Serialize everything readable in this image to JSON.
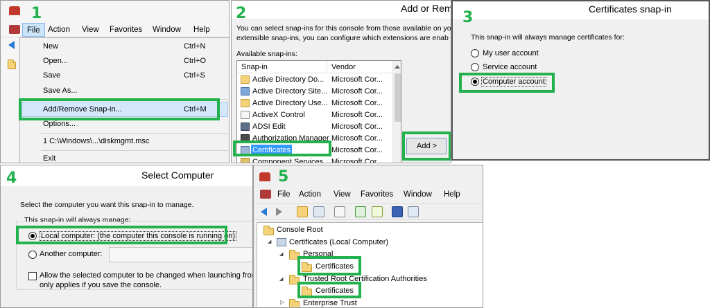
{
  "step_numbers": [
    "1",
    "2",
    "3",
    "4",
    "5"
  ],
  "panel1": {
    "menubar": [
      "File",
      "Action",
      "View",
      "Favorites",
      "Window",
      "Help"
    ],
    "menu_items": [
      {
        "label": "New",
        "shortcut": "Ctrl+N"
      },
      {
        "label": "Open...",
        "shortcut": "Ctrl+O"
      },
      {
        "label": "Save",
        "shortcut": "Ctrl+S"
      },
      {
        "label": "Save As...",
        "shortcut": ""
      },
      {
        "label": "Add/Remove Snap-in...",
        "shortcut": "Ctrl+M"
      },
      {
        "label": "Options...",
        "shortcut": ""
      },
      {
        "label": "1 C:\\Windows\\...\\diskmgmt.msc",
        "shortcut": ""
      },
      {
        "label": "Exit",
        "shortcut": ""
      }
    ]
  },
  "panel2": {
    "title": "Add or Rem",
    "description_line1": "You can select snap-ins for this console from those available on yo",
    "description_line2": "extensible snap-ins, you can configure which extensions are enab",
    "available_label": "Available snap-ins:",
    "columns": [
      "Snap-in",
      "Vendor"
    ],
    "rows": [
      {
        "name": "Active Directory Do...",
        "vendor": "Microsoft Cor...",
        "icon": "folder-icon"
      },
      {
        "name": "Active Directory Site...",
        "vendor": "Microsoft Cor...",
        "icon": "network-icon"
      },
      {
        "name": "Active Directory Use...",
        "vendor": "Microsoft Cor...",
        "icon": "folder-icon"
      },
      {
        "name": "ActiveX Control",
        "vendor": "Microsoft Cor...",
        "icon": "page-icon"
      },
      {
        "name": "ADSI Edit",
        "vendor": "Microsoft Cor...",
        "icon": "adsi-icon"
      },
      {
        "name": "Authorization Manager",
        "vendor": "Microsoft Cor...",
        "icon": "authorization-icon"
      },
      {
        "name": "Certificates",
        "vendor": "Microsoft Cor...",
        "icon": "certificates-icon"
      },
      {
        "name": "Component Services",
        "vendor": "Microsoft Cor...",
        "icon": "component-icon"
      }
    ],
    "add_button": "Add >"
  },
  "panel3": {
    "title": "Certificates snap-in",
    "prompt": "This snap-in will always manage certificates for:",
    "options": [
      "My user account",
      "Service account",
      "Computer account"
    ],
    "selected": "Computer account"
  },
  "panel4": {
    "title": "Select Computer",
    "prompt": "Select the computer you want this snap-in to manage.",
    "group_label": "This snap-in will always manage:",
    "local_option": "Local computer:  (the computer this console is running on)",
    "another_option": "Another computer:",
    "another_value": "",
    "allow_line1": "Allow the selected computer to be changed when launching from th",
    "allow_line2": "only applies if you save the console."
  },
  "panel5": {
    "menubar": [
      "File",
      "Action",
      "View",
      "Favorites",
      "Window",
      "Help"
    ],
    "tree": [
      {
        "label": "Console Root"
      },
      {
        "label": "Certificates (Local Computer)"
      },
      {
        "label": "Personal"
      },
      {
        "label": "Certificates"
      },
      {
        "label": "Trusted Root Certification Authorities"
      },
      {
        "label": "Certificates"
      },
      {
        "label": "Enterprise Trust"
      }
    ]
  },
  "colors": {
    "highlight": "#22b14c",
    "selection": "#cce8ff",
    "menu_hover": "#d5e8fb"
  }
}
